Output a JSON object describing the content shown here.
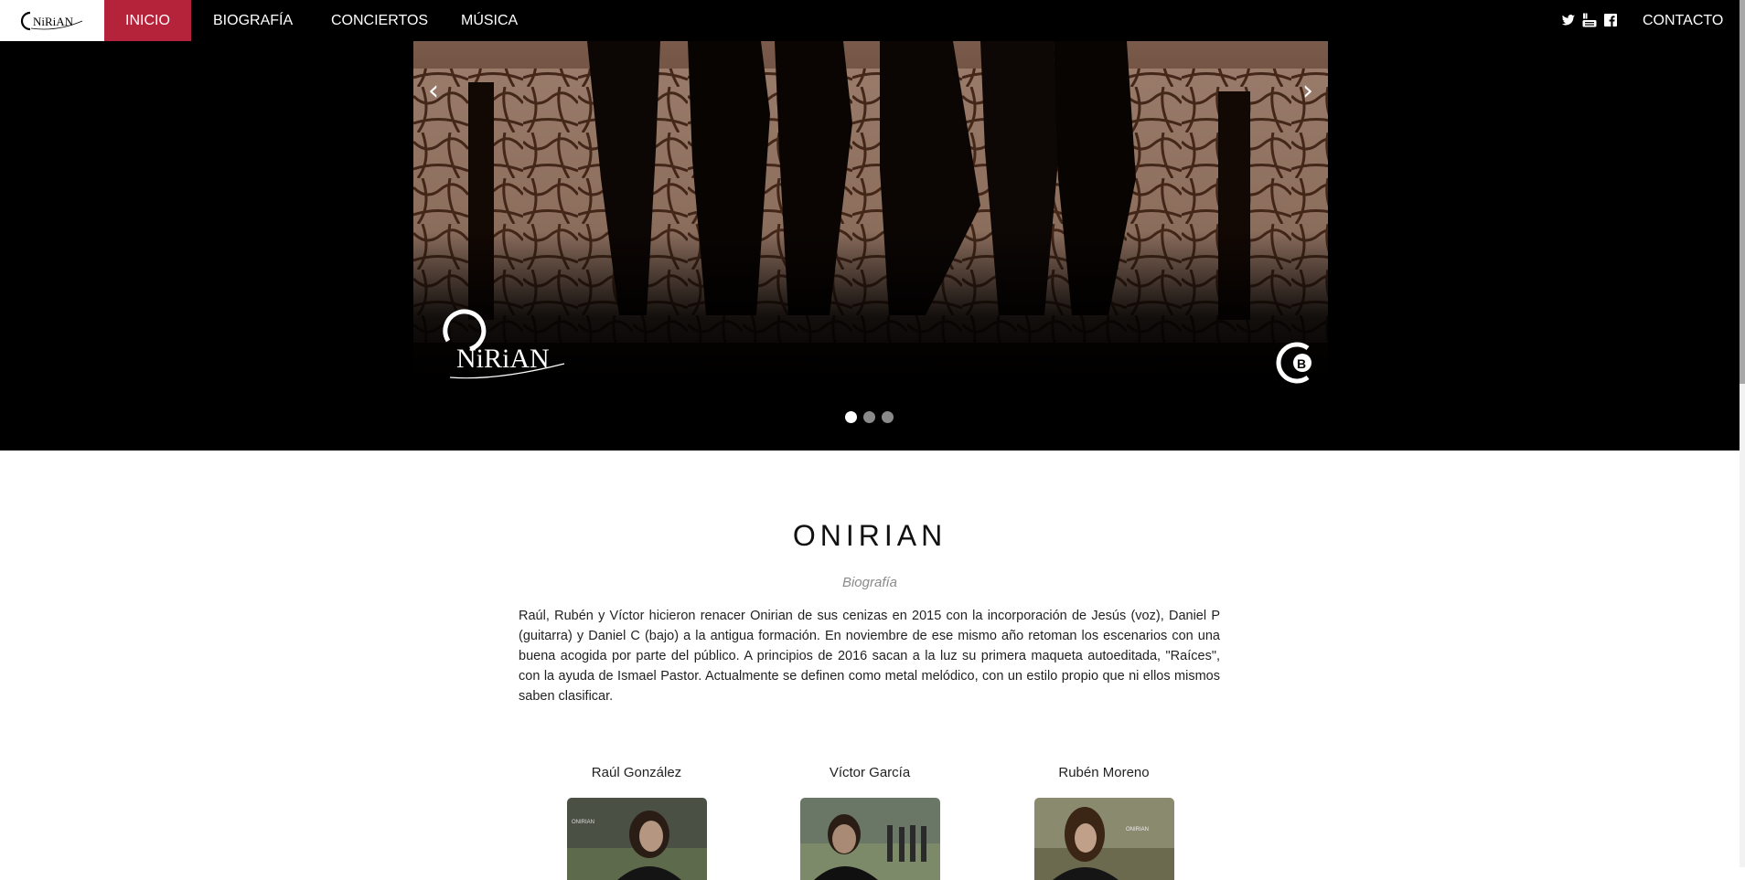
{
  "nav": {
    "brand_logo": "onirian-logo",
    "items": [
      {
        "label": "INICIO",
        "active": true
      },
      {
        "label": "BIOGRAFÍA",
        "active": false
      },
      {
        "label": "CONCIERTOS",
        "active": false
      },
      {
        "label": "MÚSICA",
        "active": false
      }
    ],
    "social_icons": [
      "twitter-icon",
      "youtube-icon",
      "facebook-icon"
    ],
    "contact_label": "CONTACTO",
    "active_color": "#b5233a"
  },
  "hero": {
    "prev_arrow": "‹",
    "next_arrow": "›",
    "slide_count": 3,
    "active_slide": 1
  },
  "band": {
    "title": "ONIRIAN",
    "subtitle": "Biografía",
    "bio": "Raúl, Rubén y Víctor hicieron renacer Onirian de sus cenizas en 2015 con la incorporación de Jesús (voz), Daniel P (guitarra) y Daniel C (bajo) a la antigua formación. En noviembre de ese mismo año retoman los escenarios con una buena acogida por parte del público. A principios de 2016 sacan a la luz su primera maqueta autoeditada, \"Raíces\", con la ayuda de Ismael Pastor. Actualmente se definen como metal melódico, con un estilo propio que ni ellos mismos saben clasificar."
  },
  "members": [
    {
      "name": "Raúl González"
    },
    {
      "name": "Víctor García"
    },
    {
      "name": "Rubén Moreno"
    }
  ]
}
